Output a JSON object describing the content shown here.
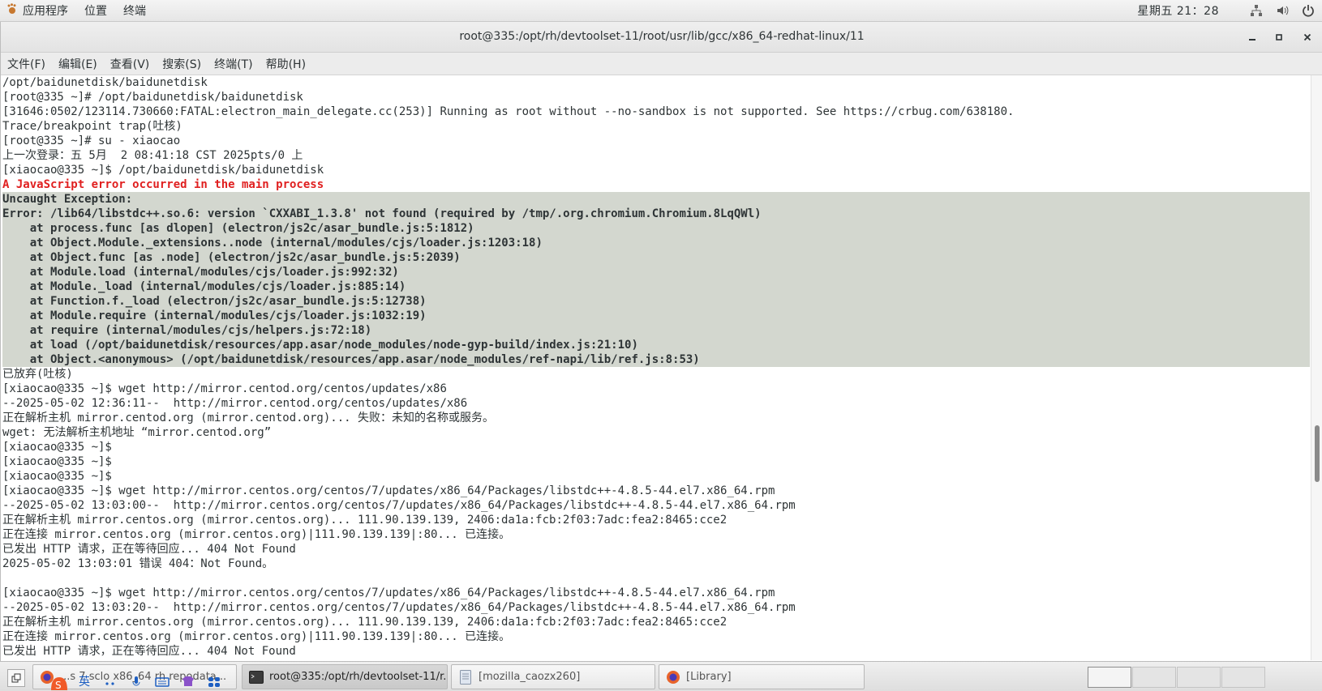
{
  "top_panel": {
    "applications": "应用程序",
    "places": "位置",
    "terminal": "终端",
    "clock": "星期五 21：28"
  },
  "window": {
    "title": "root@335:/opt/rh/devtoolset-11/root/usr/lib/gcc/x86_64-redhat-linux/11",
    "menu": [
      "文件(F)",
      "编辑(E)",
      "查看(V)",
      "搜索(S)",
      "终端(T)",
      "帮助(H)"
    ]
  },
  "terminal": {
    "lines": [
      {
        "text": "/opt/baidunetdisk/baidunetdisk",
        "style": "normal"
      },
      {
        "text": "[root@335 ~]# /opt/baidunetdisk/baidunetdisk",
        "style": "normal"
      },
      {
        "text": "[31646:0502/123114.730660:FATAL:electron_main_delegate.cc(253)] Running as root without --no-sandbox is not supported. See https://crbug.com/638180.",
        "style": "normal"
      },
      {
        "text": "Trace/breakpoint trap(吐核)",
        "style": "normal"
      },
      {
        "text": "[root@335 ~]# su - xiaocao",
        "style": "normal"
      },
      {
        "text": "上一次登录：五 5月  2 08:41:18 CST 2025pts/0 上",
        "style": "normal"
      },
      {
        "text": "[xiaocao@335 ~]$ /opt/baidunetdisk/baidunetdisk",
        "style": "normal"
      },
      {
        "text": "A JavaScript error occurred in the main process",
        "style": "error"
      },
      {
        "text": "Uncaught Exception:",
        "style": "selected"
      },
      {
        "text": "Error: /lib64/libstdc++.so.6: version `CXXABI_1.3.8' not found (required by /tmp/.org.chromium.Chromium.8LqQWl)",
        "style": "selected"
      },
      {
        "text": "    at process.func [as dlopen] (electron/js2c/asar_bundle.js:5:1812)",
        "style": "selected"
      },
      {
        "text": "    at Object.Module._extensions..node (internal/modules/cjs/loader.js:1203:18)",
        "style": "selected"
      },
      {
        "text": "    at Object.func [as .node] (electron/js2c/asar_bundle.js:5:2039)",
        "style": "selected"
      },
      {
        "text": "    at Module.load (internal/modules/cjs/loader.js:992:32)",
        "style": "selected"
      },
      {
        "text": "    at Module._load (internal/modules/cjs/loader.js:885:14)",
        "style": "selected"
      },
      {
        "text": "    at Function.f._load (electron/js2c/asar_bundle.js:5:12738)",
        "style": "selected"
      },
      {
        "text": "    at Module.require (internal/modules/cjs/loader.js:1032:19)",
        "style": "selected"
      },
      {
        "text": "    at require (internal/modules/cjs/helpers.js:72:18)",
        "style": "selected"
      },
      {
        "text": "    at load (/opt/baidunetdisk/resources/app.asar/node_modules/node-gyp-build/index.js:21:10)",
        "style": "selected"
      },
      {
        "text": "    at Object.<anonymous> (/opt/baidunetdisk/resources/app.asar/node_modules/ref-napi/lib/ref.js:8:53)",
        "style": "selected"
      },
      {
        "text": "已放弃(吐核)",
        "style": "normal"
      },
      {
        "text": "[xiaocao@335 ~]$ wget http://mirror.centod.org/centos/updates/x86",
        "style": "normal"
      },
      {
        "text": "--2025-05-02 12:36:11--  http://mirror.centod.org/centos/updates/x86",
        "style": "normal"
      },
      {
        "text": "正在解析主机 mirror.centod.org (mirror.centod.org)... 失败：未知的名称或服务。",
        "style": "normal"
      },
      {
        "text": "wget: 无法解析主机地址 “mirror.centod.org”",
        "style": "normal"
      },
      {
        "text": "[xiaocao@335 ~]$",
        "style": "normal"
      },
      {
        "text": "[xiaocao@335 ~]$",
        "style": "normal"
      },
      {
        "text": "[xiaocao@335 ~]$",
        "style": "normal"
      },
      {
        "text": "[xiaocao@335 ~]$ wget http://mirror.centos.org/centos/7/updates/x86_64/Packages/libstdc++-4.8.5-44.el7.x86_64.rpm",
        "style": "normal"
      },
      {
        "text": "--2025-05-02 13:03:00--  http://mirror.centos.org/centos/7/updates/x86_64/Packages/libstdc++-4.8.5-44.el7.x86_64.rpm",
        "style": "normal"
      },
      {
        "text": "正在解析主机 mirror.centos.org (mirror.centos.org)... 111.90.139.139, 2406:da1a:fcb:2f03:7adc:fea2:8465:cce2",
        "style": "normal"
      },
      {
        "text": "正在连接 mirror.centos.org (mirror.centos.org)|111.90.139.139|:80... 已连接。",
        "style": "normal"
      },
      {
        "text": "已发出 HTTP 请求，正在等待回应... 404 Not Found",
        "style": "normal"
      },
      {
        "text": "2025-05-02 13:03:01 错误 404：Not Found。",
        "style": "normal"
      },
      {
        "text": "",
        "style": "normal"
      },
      {
        "text": "[xiaocao@335 ~]$ wget http://mirror.centos.org/centos/7/updates/x86_64/Packages/libstdc++-4.8.5-44.el7.x86_64.rpm",
        "style": "normal"
      },
      {
        "text": "--2025-05-02 13:03:20--  http://mirror.centos.org/centos/7/updates/x86_64/Packages/libstdc++-4.8.5-44.el7.x86_64.rpm",
        "style": "normal"
      },
      {
        "text": "正在解析主机 mirror.centos.org (mirror.centos.org)... 111.90.139.139, 2406:da1a:fcb:2f03:7adc:fea2:8465:cce2",
        "style": "normal"
      },
      {
        "text": "正在连接 mirror.centos.org (mirror.centos.org)|111.90.139.139|:80... 已连接。",
        "style": "normal"
      },
      {
        "text": "已发出 HTTP 请求，正在等待回应... 404 Not Found",
        "style": "normal"
      }
    ]
  },
  "taskbar": {
    "tasks": [
      {
        "label": "...s 7 sclo x86_64 rh repodata...",
        "icon": "firefox-icon",
        "active": false
      },
      {
        "label": "root@335:/opt/rh/devtoolset-11/r...",
        "icon": "terminal-icon",
        "active": true
      },
      {
        "label": "[mozilla_caozx260]",
        "icon": "file-manager-icon",
        "active": false
      },
      {
        "label": "[Library]",
        "icon": "firefox-icon",
        "active": false
      }
    ],
    "ime": {
      "mode": "英",
      "items": [
        "ime-punct-icon",
        "ime-voice-icon",
        "ime-keyboard-icon",
        "ime-skin-icon",
        "ime-toolbox-icon"
      ]
    }
  },
  "colors": {
    "error_text": "#e02020",
    "selection_bg": "#d3d7cf",
    "text": "#2e3436"
  }
}
